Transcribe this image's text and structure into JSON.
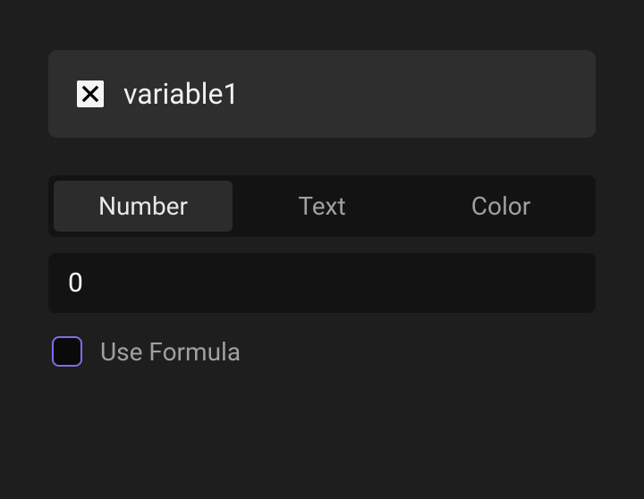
{
  "variable": {
    "name": "variable1",
    "icon": "variable-x-icon"
  },
  "typeTabs": {
    "items": [
      {
        "label": "Number",
        "active": true
      },
      {
        "label": "Text",
        "active": false
      },
      {
        "label": "Color",
        "active": false
      }
    ]
  },
  "valueInput": {
    "value": "0"
  },
  "formula": {
    "label": "Use Formula",
    "checked": false
  },
  "colors": {
    "background": "#1e1e1e",
    "card": "#2e2e2e",
    "inputBg": "#131313",
    "tabActiveBg": "#2c2c2c",
    "textPrimary": "#f0f0f0",
    "textMuted": "#a0a0a0",
    "checkboxBorder": "#7b6fe8"
  }
}
